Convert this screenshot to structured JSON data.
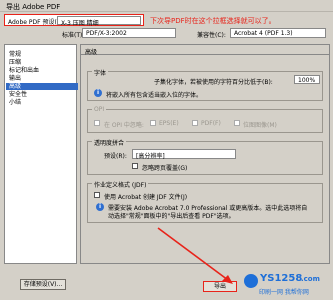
{
  "window": {
    "title": "导出 Adobe PDF"
  },
  "top": {
    "preset_label": "Adobe PDF 预设(P):",
    "preset_value": "X-3 压图 精细",
    "annotation": "下次导PDF时在这个拉框选择就可以了。",
    "standard_label": "标准(T):",
    "standard_value": "PDF/X-3:2002",
    "compat_label": "兼容性(C):",
    "compat_value": "Acrobat 4 (PDF 1.3)"
  },
  "sidebar": {
    "items": [
      {
        "label": "常规",
        "selected": false
      },
      {
        "label": "压缩",
        "selected": false
      },
      {
        "label": "标记和出血",
        "selected": false
      },
      {
        "label": "输出",
        "selected": false
      },
      {
        "label": "高级",
        "selected": true
      },
      {
        "label": "安全性",
        "selected": false
      },
      {
        "label": "小结",
        "selected": false
      }
    ]
  },
  "panel": {
    "heading": "高级",
    "fonts": {
      "title": "字体",
      "subset_label": "子集化字体，若被使用的字符百分比低于(B):",
      "subset_value": "100%",
      "info_text": "将嵌入所有包含适当嵌入位的字体。"
    },
    "opi": {
      "title": "OPI",
      "label": "在 OPI 中忽略:",
      "options": [
        "EPS(E)",
        "PDF(F)",
        "位图图像(M)"
      ]
    },
    "transparency": {
      "title": "透明度拼合",
      "preset_label": "预设(R):",
      "preset_value": "[高分辨率]",
      "override_label": "忽略跨页覆盖(G)"
    },
    "job": {
      "title": "作业定义格式 (JDF)",
      "checkbox_label": "使用 Acrobat 创建 JDF 文件(J)",
      "info_line1": "需要安装 Adobe Acrobat 7.0 Professional 或更高版本。选中此选项将自",
      "info_line2": "动选择\"常规\"面板中的\"导出后查看 PDF\"选项。"
    }
  },
  "footer": {
    "save_preset": "存储预设(V)...",
    "export": "导出",
    "watermark_brand": "YS1258",
    "watermark_suffix": ".com",
    "watermark_sub": "印刷一网 我帮你网"
  },
  "colors": {
    "annotation": "#e8231a",
    "selection": "#316ac5",
    "watermark": "#1e6fd8"
  }
}
